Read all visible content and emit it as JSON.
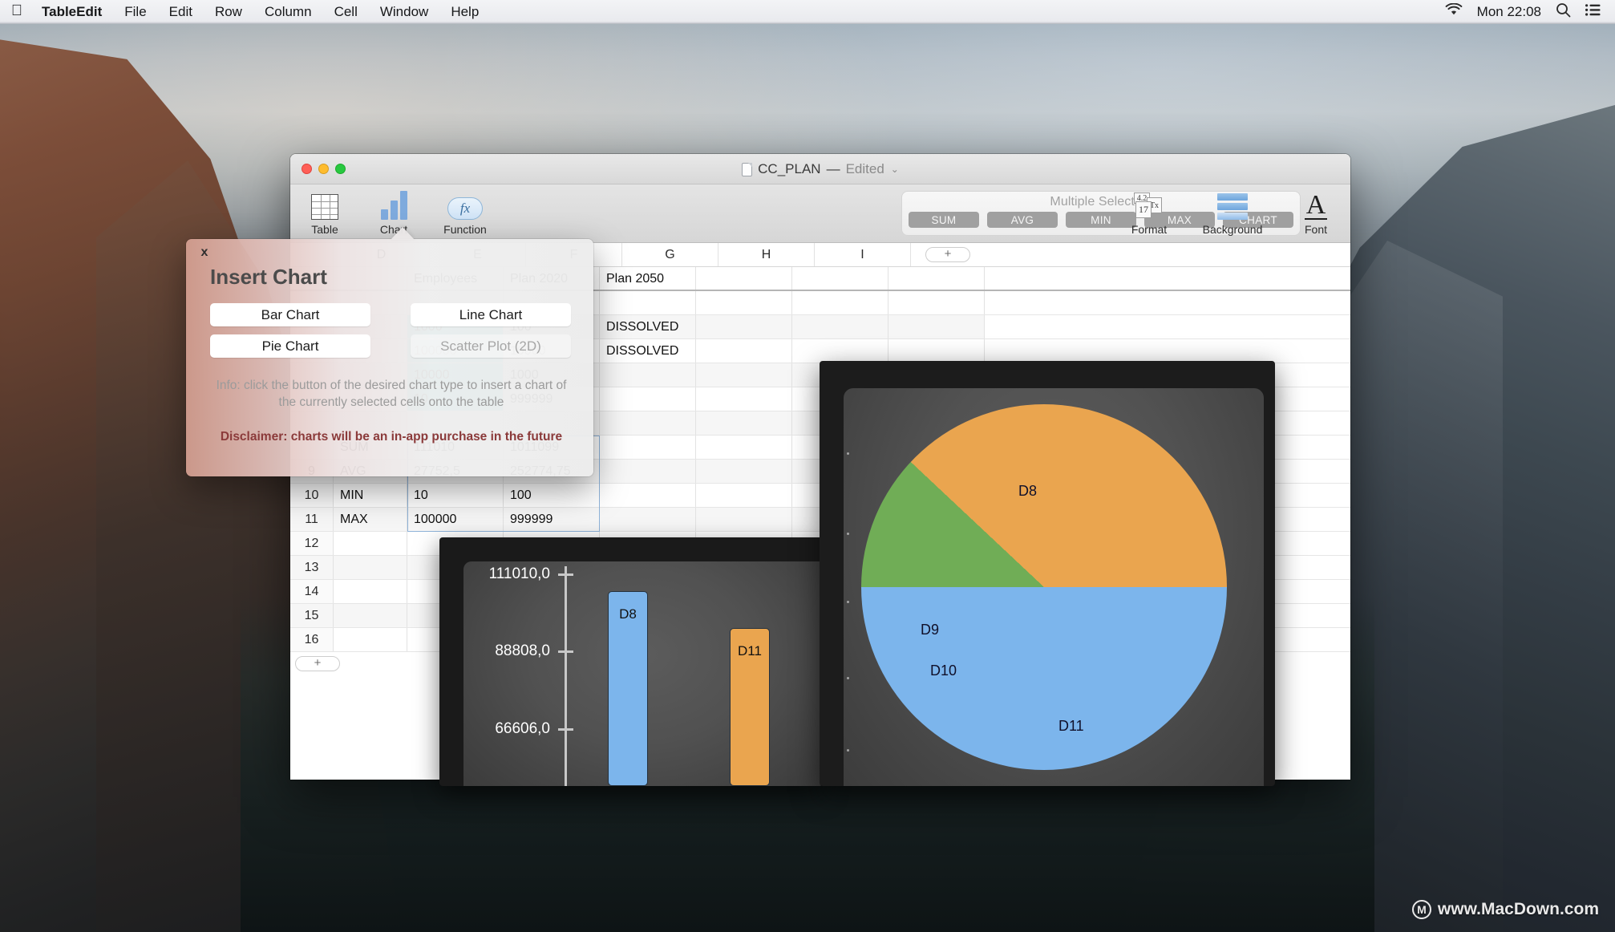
{
  "menubar": {
    "apple_icon": "apple-logo",
    "items": [
      "TableEdit",
      "File",
      "Edit",
      "Row",
      "Column",
      "Cell",
      "Window",
      "Help"
    ],
    "status": {
      "wifi_icon": "wifi-icon",
      "clock": "Mon 22:08",
      "search_icon": "search-icon",
      "notification_center_icon": "notification-center-icon"
    }
  },
  "window": {
    "title": "CC_PLAN",
    "separator": "—",
    "edited": "Edited",
    "chevron": "⌄",
    "doc_icon": "document-icon"
  },
  "toolbar": {
    "left_items": [
      {
        "label": "Table",
        "icon": "table-icon"
      },
      {
        "label": "Chart",
        "icon": "bar-chart-icon"
      },
      {
        "label": "Function",
        "icon": "function-fx-icon"
      }
    ],
    "right_items": [
      {
        "label": "Format",
        "icon": "format-icon"
      },
      {
        "label": "Background",
        "icon": "background-icon"
      },
      {
        "label": "Font",
        "icon": "font-icon"
      }
    ],
    "selection": {
      "title": "Multiple Selection",
      "buttons": [
        "SUM",
        "AVG",
        "MIN",
        "MAX",
        "CHART"
      ]
    }
  },
  "sheet": {
    "column_headers": [
      "D",
      "E",
      "F",
      "G",
      "H",
      "I"
    ],
    "add_column_label": "+",
    "add_row_label": "+",
    "header_row": {
      "number": "",
      "label": "",
      "cells": [
        "Employees",
        "Plan 2020",
        "Plan 2050",
        "",
        "",
        ""
      ]
    },
    "rows": [
      {
        "number": "",
        "label": "",
        "cells": [
          "",
          "",
          "",
          "",
          "",
          ""
        ],
        "selected": []
      },
      {
        "number": "",
        "label": "",
        "cells": [
          "1000",
          "100",
          "DISSOLVED",
          "",
          "",
          ""
        ],
        "selected": [
          0
        ]
      },
      {
        "number": "",
        "label": "",
        "cells": [
          "100000",
          "10000",
          "DISSOLVED",
          "",
          "",
          ""
        ],
        "selected": [
          0
        ]
      },
      {
        "number": "",
        "label": "",
        "cells": [
          "10000",
          "1000",
          "",
          "",
          "",
          ""
        ],
        "selected": [
          0
        ]
      },
      {
        "number": "",
        "label": "",
        "cells": [
          "10",
          "999999",
          "",
          "",
          "",
          ""
        ],
        "selected": [
          0
        ]
      },
      {
        "number": "",
        "label": "",
        "cells": [
          "",
          "",
          "",
          "",
          "",
          ""
        ],
        "selected": []
      },
      {
        "number": "",
        "label": "SUM",
        "cells": [
          "111010",
          "1011099",
          "",
          "",
          "",
          ""
        ],
        "selected": []
      },
      {
        "number": "9",
        "label": "AVG",
        "cells": [
          "27752,5",
          "252774,75",
          "",
          "",
          "",
          ""
        ],
        "selected": []
      },
      {
        "number": "10",
        "label": "MIN",
        "cells": [
          "10",
          "100",
          "",
          "",
          "",
          ""
        ],
        "selected": []
      },
      {
        "number": "11",
        "label": "MAX",
        "cells": [
          "100000",
          "999999",
          "",
          "",
          "",
          ""
        ],
        "selected": []
      },
      {
        "number": "12",
        "label": "",
        "cells": [
          "",
          "",
          "",
          "",
          "",
          ""
        ],
        "selected": []
      },
      {
        "number": "13",
        "label": "",
        "cells": [
          "",
          "",
          "",
          "",
          "",
          ""
        ],
        "selected": []
      },
      {
        "number": "14",
        "label": "",
        "cells": [
          "",
          "",
          "",
          "",
          "",
          ""
        ],
        "selected": []
      },
      {
        "number": "15",
        "label": "",
        "cells": [
          "",
          "",
          "",
          "",
          "",
          ""
        ],
        "selected": []
      },
      {
        "number": "16",
        "label": "",
        "cells": [
          "",
          "",
          "",
          "",
          "",
          ""
        ],
        "selected": []
      }
    ]
  },
  "insert_chart_popover": {
    "close_label": "x",
    "title": "Insert Chart",
    "buttons": [
      {
        "label": "Bar Chart",
        "enabled": true
      },
      {
        "label": "Line Chart",
        "enabled": true
      },
      {
        "label": "Pie Chart",
        "enabled": true
      },
      {
        "label": "Scatter Plot (2D)",
        "enabled": false
      }
    ],
    "info": "Info: click the button of the desired chart type to insert a chart of the currently selected cells onto the table",
    "disclaimer": "Disclaimer: charts will be an in-app purchase in the future"
  },
  "colors": {
    "selection_cyan": "#63e3e8",
    "series_blue": "#7cb5ec",
    "series_green": "#70ad56",
    "series_orange": "#eaa54f",
    "chart_background": "#4e4e4e",
    "disclaimer_red": "#8b3a3a"
  },
  "watermark": {
    "text": "www.MacDown.com",
    "badge": "M"
  },
  "chart_data": [
    {
      "type": "bar",
      "title": "",
      "categories": [
        "D8",
        "D11"
      ],
      "values": [
        100000,
        90000
      ],
      "labels": [
        "D8",
        "D11"
      ],
      "colors": [
        "#7cb5ec",
        "#eaa54f"
      ],
      "ytick_labels": [
        "111010,0",
        "88808,0",
        "66606,0"
      ],
      "ytick_values": [
        111010.0,
        88808.0,
        66606.0
      ],
      "ylim": [
        0,
        111010
      ],
      "xlabel": "",
      "ylabel": "",
      "grid": false,
      "legend": "none"
    },
    {
      "type": "pie",
      "title": "",
      "categories": [
        "D8",
        "D9",
        "D10",
        "D11"
      ],
      "labels": [
        "D8",
        "D9",
        "D10",
        "D11"
      ],
      "values": [
        50,
        11,
        1,
        38
      ],
      "colors": [
        "#7cb5ec",
        "#70ad56",
        "#70ad56",
        "#eaa54f"
      ],
      "legend": "none"
    }
  ]
}
